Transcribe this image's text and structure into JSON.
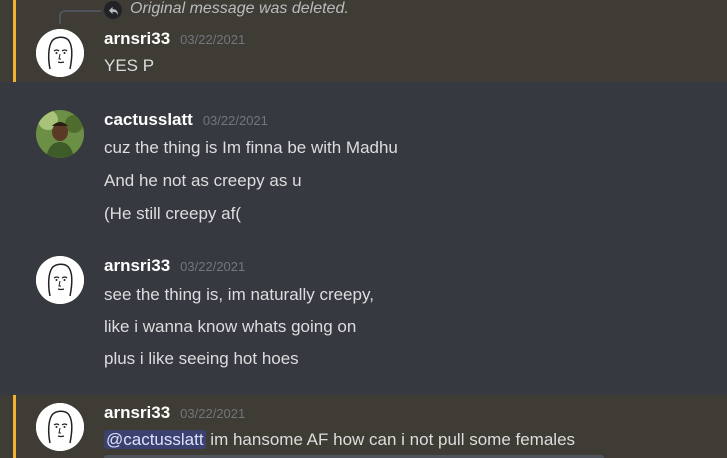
{
  "reply_preview": {
    "text": "Original message was deleted."
  },
  "messages": [
    {
      "username": "arnsri33",
      "timestamp": "03/22/2021",
      "lines": [
        "YES P"
      ]
    },
    {
      "username": "cactusslatt",
      "timestamp": "03/22/2021",
      "lines": [
        "cuz the thing is Im finna be with Madhu",
        "And he not as creepy as u",
        "(He still creepy af("
      ]
    },
    {
      "username": "arnsri33",
      "timestamp": "03/22/2021",
      "lines": [
        "see the thing is, im naturally creepy,",
        "like i wanna know whats going on",
        "plus i like seeing hot hoes"
      ]
    },
    {
      "username": "arnsri33",
      "timestamp": "03/22/2021",
      "mention": "@cactusslatt",
      "text": " im hansome AF how can i not pull some females"
    }
  ],
  "colors": {
    "background": "#36393f",
    "highlight": "#3e3c34",
    "highlight_bar": "#f0b232",
    "mention_bg": "#3c4270"
  }
}
